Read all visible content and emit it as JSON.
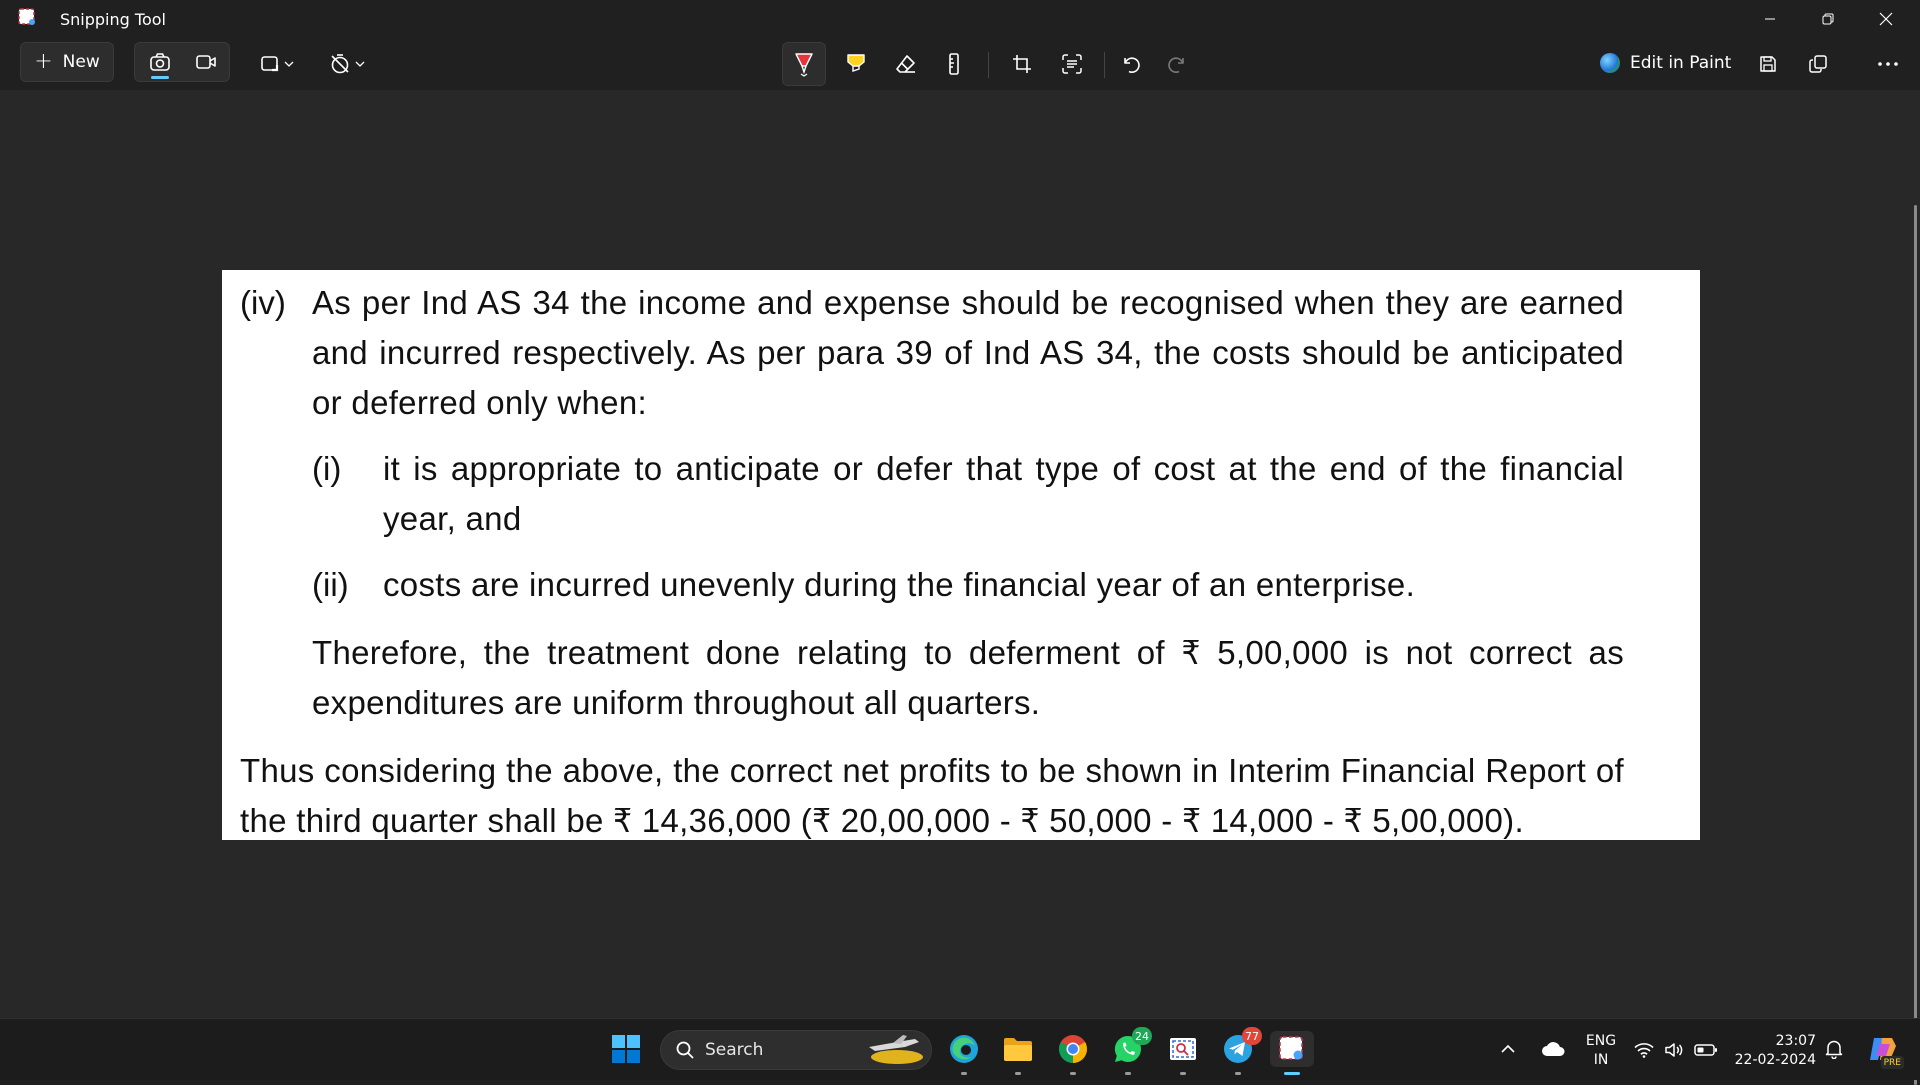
{
  "window": {
    "title": "Snipping Tool"
  },
  "toolbar": {
    "new_label": "New",
    "edit_in_paint_label": "Edit in Paint"
  },
  "document": {
    "para_iv_label": "(iv)",
    "para_iv_text": "As per Ind AS 34 the income and expense should be recognised when they are earned and incurred respectively. As per para 39 of Ind AS 34, the costs should be anticipated or deferred only when:",
    "item_i_label": "(i)",
    "item_i_text": "it is appropriate to anticipate or defer that type of cost at the end of the financial year, and",
    "item_ii_label": "(ii)",
    "item_ii_text": "costs are incurred unevenly during the financial year of an enterprise.",
    "therefore_text": "Therefore, the treatment done relating to deferment of ₹  5,00,000 is not correct as expenditures are uniform throughout all quarters.",
    "conclusion_text": "Thus considering the above, the correct net profits to be shown in Interim Financial Report of the third quarter shall be ₹ 14,36,000 (₹ 20,00,000 - ₹ 50,000 - ₹ 14,000 - ₹ 5,00,000)."
  },
  "taskbar": {
    "search_label": "Search",
    "whatsapp_badge": "24",
    "telegram_badge": "77",
    "language_line1": "ENG",
    "language_line2": "IN",
    "time": "23:07",
    "date": "22-02-2024",
    "copilot_badge": "PRE"
  },
  "colors": {
    "accent": "#60cdff",
    "background": "#202020",
    "canvas": "#282828",
    "highlighter_red": "#e8323c",
    "highlighter_yellow": "#ffd21f"
  },
  "icons": {
    "window_controls": [
      "minimize-icon",
      "restore-icon",
      "close-icon"
    ],
    "toolbar": [
      "camera-icon",
      "video-icon",
      "rectangle-mode-icon",
      "no-timer-icon",
      "ballpoint-pen-icon",
      "highlighter-icon",
      "eraser-icon",
      "ruler-icon",
      "crop-icon",
      "text-actions-icon",
      "undo-icon",
      "redo-icon",
      "save-icon",
      "copy-icon",
      "more-icon"
    ],
    "taskbar": [
      "windows-start-icon",
      "search-icon",
      "edge-icon",
      "file-explorer-icon",
      "chrome-icon",
      "whatsapp-icon",
      "snip-app-icon",
      "telegram-icon",
      "snipping-tool-icon",
      "chevron-up-icon",
      "onedrive-icon",
      "wifi-icon",
      "volume-icon",
      "battery-icon",
      "bell-icon",
      "copilot-icon"
    ]
  }
}
